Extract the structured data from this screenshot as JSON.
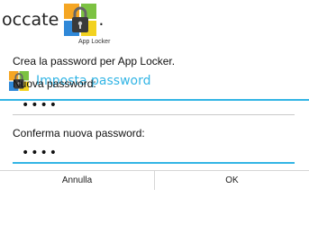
{
  "document": {
    "text_fragment": "occate",
    "trailing_punct": ".",
    "icon": "app-locker-lock-icon",
    "icon_caption": "App Locker"
  },
  "dialog": {
    "icon": "app-locker-lock-icon",
    "title": "Imposta password",
    "message": "Crea la password per App Locker.",
    "new_password_label": "Nuova password:",
    "new_password_value": "••••",
    "confirm_password_label": "Conferma nuova password:",
    "confirm_password_value": "••••",
    "cancel_label": "Annulla",
    "ok_label": "OK"
  },
  "colors": {
    "accent": "#33b5e5",
    "divider": "#d6d6d6",
    "icon_orange": "#f5a623",
    "icon_green": "#7cc242",
    "icon_blue": "#2f88d8",
    "icon_yellow": "#f2d21f"
  }
}
